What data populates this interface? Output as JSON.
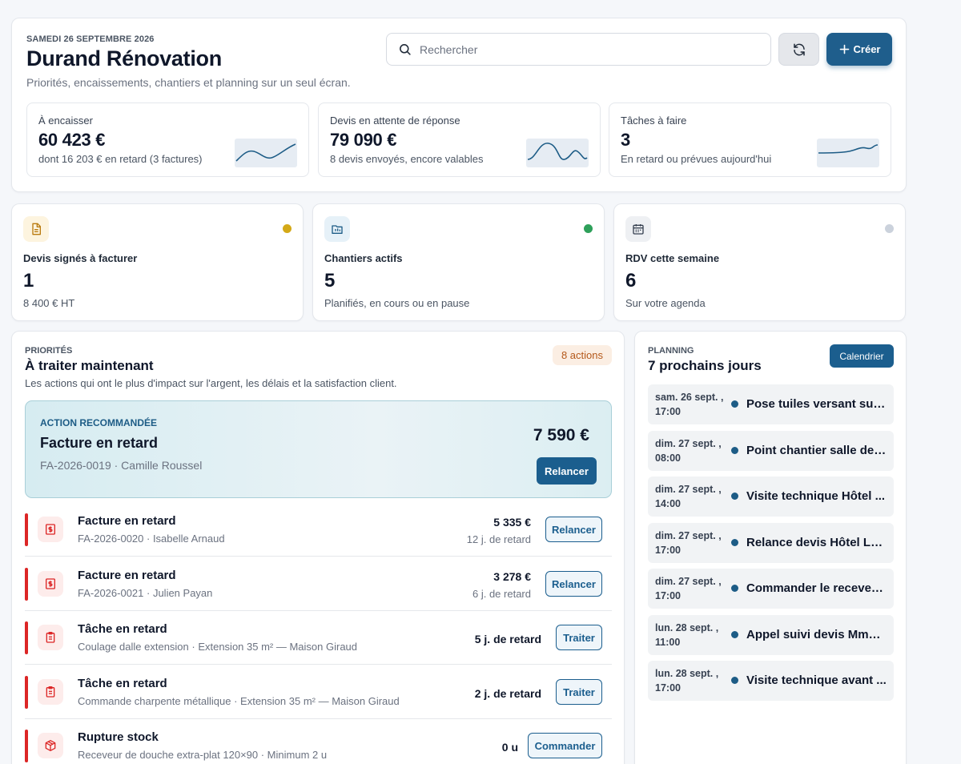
{
  "header": {
    "date": "SAMEDI 26 SEPTEMBRE 2026",
    "title": "Durand Rénovation",
    "subtitle": "Priorités, encaissements, chantiers et planning sur un seul écran.",
    "search_placeholder": "Rechercher",
    "create_label": "Créer",
    "refresh_icon": "refresh-icon",
    "create_icon": "plus-icon"
  },
  "kpis": [
    {
      "label": "À encaisser",
      "value": "60 423 €",
      "note": "dont 16 203 € en retard (3 factures)",
      "icon": "sparkline-icon"
    },
    {
      "label": "Devis en attente de réponse",
      "value": "79 090 €",
      "note": "8 devis envoyés, encore valables",
      "icon": "sparkline-icon"
    },
    {
      "label": "Tâches à faire",
      "value": "3",
      "note": "En retard ou prévues aujourd'hui",
      "icon": "sparkline-icon"
    }
  ],
  "stats": [
    {
      "label": "Devis signés à facturer",
      "value": "1",
      "note": "8 400 € HT",
      "icon": "document-icon",
      "dot_color": "#d4a917"
    },
    {
      "label": "Chantiers actifs",
      "value": "5",
      "note": "Planifiés, en cours ou en pause",
      "icon": "folder-chart-icon",
      "dot_color": "#2ea05a"
    },
    {
      "label": "RDV cette semaine",
      "value": "6",
      "note": "Sur votre agenda",
      "icon": "calendar-icon",
      "dot_color": "#cbd2dc"
    }
  ],
  "priorities": {
    "kicker": "PRIORITÉS",
    "title": "À traiter maintenant",
    "description": "Les actions qui ont le plus d'impact sur l'argent, les délais et la satisfaction client.",
    "badge": "8 actions",
    "recommended": {
      "kicker": "ACTION RECOMMANDÉE",
      "title": "Facture en retard",
      "subtitle": "FA-2026-0019 · Camille Roussel",
      "amount": "7 590 €",
      "button": "Relancer"
    },
    "rows": [
      {
        "title": "Facture en retard",
        "subtitle": "FA-2026-0020 · Isabelle Arnaud",
        "amount": "5 335 €",
        "late": "12 j. de retard",
        "button": "Relancer",
        "icon": "invoice-dollar-icon"
      },
      {
        "title": "Facture en retard",
        "subtitle": "FA-2026-0021 · Julien Payan",
        "amount": "3 278 €",
        "late": "6 j. de retard",
        "button": "Relancer",
        "icon": "invoice-dollar-icon"
      },
      {
        "title": "Tâche en retard",
        "subtitle": "Coulage dalle extension · Extension 35 m² — Maison Giraud",
        "amount": "5 j. de retard",
        "late": "",
        "button": "Traiter",
        "icon": "clipboard-icon"
      },
      {
        "title": "Tâche en retard",
        "subtitle": "Commande charpente métallique · Extension 35 m² — Maison Giraud",
        "amount": "2 j. de retard",
        "late": "",
        "button": "Traiter",
        "icon": "clipboard-icon"
      },
      {
        "title": "Rupture stock",
        "subtitle": "Receveur de douche extra-plat 120×90 · Minimum 2 u",
        "amount": "0 u",
        "late": "",
        "button": "Commander",
        "icon": "box-icon"
      }
    ]
  },
  "planning": {
    "kicker": "PLANNING",
    "title": "7 prochains jours",
    "calendar_button": "Calendrier",
    "items": [
      {
        "date": "sam. 26 sept. , 17:00",
        "title": "Pose tuiles versant sud · ..."
      },
      {
        "date": "dim. 27 sept. , 08:00",
        "title": "Point chantier salle de ..."
      },
      {
        "date": "dim. 27 sept. , 14:00",
        "title": "Visite technique Hôtel ..."
      },
      {
        "date": "dim. 27 sept. , 17:00",
        "title": "Relance devis Hôtel Le ..."
      },
      {
        "date": "dim. 27 sept. , 17:00",
        "title": "Commander le receveu..."
      },
      {
        "date": "lun. 28 sept. , 11:00",
        "title": "Appel suivi devis Mme ..."
      },
      {
        "date": "lun. 28 sept. , 17:00",
        "title": "Visite technique avant ..."
      }
    ]
  },
  "colors": {
    "accent": "#1b5e8e",
    "danger": "#dc2626",
    "badge_bg": "#fbeee3",
    "badge_text": "#b4581a"
  }
}
